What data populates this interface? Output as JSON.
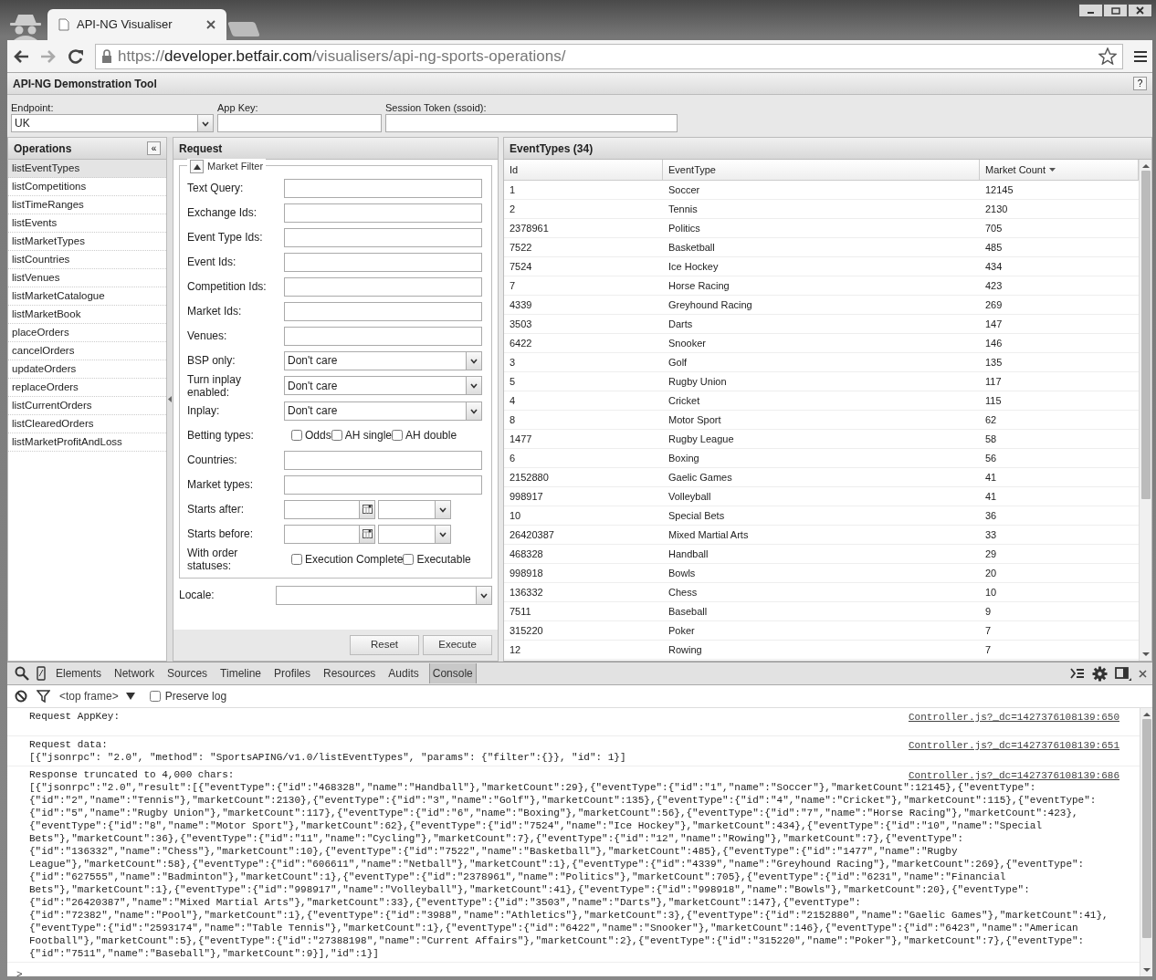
{
  "browser": {
    "tab": {
      "title": "API-NG Visualiser"
    },
    "address": {
      "scheme": "https://",
      "host": "developer.betfair.com",
      "path": "/visualisers/api-ng-sports-operations/"
    }
  },
  "app": {
    "title": "API-NG Demonstration Tool",
    "help": "?",
    "connection": [
      {
        "label": "Endpoint:",
        "kind": "select",
        "value": "UK"
      },
      {
        "label": "App Key:",
        "kind": "text"
      },
      {
        "label": "Session Token (ssoid):",
        "kind": "text"
      }
    ],
    "operations": {
      "title": "Operations",
      "collapse": "«",
      "items": [
        {
          "label": "listEventTypes",
          "selected": true
        },
        {
          "label": "listCompetitions",
          "selected": false
        },
        {
          "label": "listTimeRanges",
          "selected": false
        },
        {
          "label": "listEvents",
          "selected": false
        },
        {
          "label": "listMarketTypes",
          "selected": false
        },
        {
          "label": "listCountries",
          "selected": false
        },
        {
          "label": "listVenues",
          "selected": false
        },
        {
          "label": "listMarketCatalogue",
          "selected": false
        },
        {
          "label": "listMarketBook",
          "selected": false
        },
        {
          "label": "placeOrders",
          "selected": false
        },
        {
          "label": "cancelOrders",
          "selected": false
        },
        {
          "label": "updateOrders",
          "selected": false
        },
        {
          "label": "replaceOrders",
          "selected": false
        },
        {
          "label": "listCurrentOrders",
          "selected": false
        },
        {
          "label": "listClearedOrders",
          "selected": false
        },
        {
          "label": "listMarketProfitAndLoss",
          "selected": false
        }
      ]
    },
    "request": {
      "title": "Request",
      "filter_title": "Market Filter",
      "fields": [
        {
          "label": "Text Query:",
          "kind": "text"
        },
        {
          "label": "Exchange Ids:",
          "kind": "text"
        },
        {
          "label": "Event Type Ids:",
          "kind": "text"
        },
        {
          "label": "Event Ids:",
          "kind": "text"
        },
        {
          "label": "Competition Ids:",
          "kind": "text"
        },
        {
          "label": "Market Ids:",
          "kind": "text"
        },
        {
          "label": "Venues:",
          "kind": "text"
        },
        {
          "label": "BSP only:",
          "kind": "select",
          "value": "Don't care"
        },
        {
          "label": "Turn inplay enabled:",
          "kind": "select",
          "value": "Don't care"
        },
        {
          "label": "Inplay:",
          "kind": "select",
          "value": "Don't care"
        },
        {
          "label": "Betting types:",
          "kind": "checks",
          "options": [
            {
              "label": "Odds",
              "checked": false
            },
            {
              "label": "AH single",
              "checked": false
            },
            {
              "label": "AH double",
              "checked": false
            }
          ]
        },
        {
          "label": "Countries:",
          "kind": "text"
        },
        {
          "label": "Market types:",
          "kind": "text"
        },
        {
          "label": "Starts after:",
          "kind": "date"
        },
        {
          "label": "Starts before:",
          "kind": "date"
        },
        {
          "label": "With order statuses:",
          "kind": "checks",
          "options": [
            {
              "label": "Execution Complete",
              "checked": false
            },
            {
              "label": "Executable",
              "checked": false
            }
          ]
        }
      ],
      "locale": {
        "label": "Locale:"
      },
      "buttons": [
        "Reset",
        "Execute"
      ]
    },
    "results": {
      "title": "EventTypes (34)",
      "columns": [
        {
          "label": "Id",
          "sorted": false
        },
        {
          "label": "EventType",
          "sorted": false
        },
        {
          "label": "Market Count",
          "sorted": true
        }
      ],
      "rows": [
        [
          "1",
          "Soccer",
          "12145"
        ],
        [
          "2",
          "Tennis",
          "2130"
        ],
        [
          "2378961",
          "Politics",
          "705"
        ],
        [
          "7522",
          "Basketball",
          "485"
        ],
        [
          "7524",
          "Ice Hockey",
          "434"
        ],
        [
          "7",
          "Horse Racing",
          "423"
        ],
        [
          "4339",
          "Greyhound Racing",
          "269"
        ],
        [
          "3503",
          "Darts",
          "147"
        ],
        [
          "6422",
          "Snooker",
          "146"
        ],
        [
          "3",
          "Golf",
          "135"
        ],
        [
          "5",
          "Rugby Union",
          "117"
        ],
        [
          "4",
          "Cricket",
          "115"
        ],
        [
          "8",
          "Motor Sport",
          "62"
        ],
        [
          "1477",
          "Rugby League",
          "58"
        ],
        [
          "6",
          "Boxing",
          "56"
        ],
        [
          "2152880",
          "Gaelic Games",
          "41"
        ],
        [
          "998917",
          "Volleyball",
          "41"
        ],
        [
          "10",
          "Special Bets",
          "36"
        ],
        [
          "26420387",
          "Mixed Martial Arts",
          "33"
        ],
        [
          "468328",
          "Handball",
          "29"
        ],
        [
          "998918",
          "Bowls",
          "20"
        ],
        [
          "136332",
          "Chess",
          "10"
        ],
        [
          "7511",
          "Baseball",
          "9"
        ],
        [
          "315220",
          "Poker",
          "7"
        ],
        [
          "12",
          "Rowing",
          "7"
        ]
      ]
    }
  },
  "devtools": {
    "tabs": [
      {
        "label": "Elements",
        "selected": false
      },
      {
        "label": "Network",
        "selected": false
      },
      {
        "label": "Sources",
        "selected": false
      },
      {
        "label": "Timeline",
        "selected": false
      },
      {
        "label": "Profiles",
        "selected": false
      },
      {
        "label": "Resources",
        "selected": false
      },
      {
        "label": "Audits",
        "selected": false
      },
      {
        "label": "Console",
        "selected": true
      }
    ],
    "frame": "<top frame>",
    "preserve_log": {
      "label": "Preserve log",
      "checked": false
    },
    "messages": [
      {
        "source": "Controller.js?_dc=1427376108139:650",
        "lines": [
          "Request AppKey:"
        ]
      },
      {
        "source": "Controller.js?_dc=1427376108139:651",
        "lines": [
          "Request data:",
          "[{\"jsonrpc\": \"2.0\", \"method\": \"SportsAPING/v1.0/listEventTypes\", \"params\": {\"filter\":{}}, \"id\": 1}]"
        ]
      },
      {
        "source": "Controller.js?_dc=1427376108139:686",
        "lines": [
          "Response truncated to 4,000 chars:",
          "[{\"jsonrpc\":\"2.0\",\"result\":[{\"eventType\":{\"id\":\"468328\",\"name\":\"Handball\"},\"marketCount\":29},{\"eventType\":{\"id\":\"1\",\"name\":\"Soccer\"},\"marketCount\":12145},{\"eventType\":",
          "{\"id\":\"2\",\"name\":\"Tennis\"},\"marketCount\":2130},{\"eventType\":{\"id\":\"3\",\"name\":\"Golf\"},\"marketCount\":135},{\"eventType\":{\"id\":\"4\",\"name\":\"Cricket\"},\"marketCount\":115},{\"eventType\":",
          "{\"id\":\"5\",\"name\":\"Rugby Union\"},\"marketCount\":117},{\"eventType\":{\"id\":\"6\",\"name\":\"Boxing\"},\"marketCount\":56},{\"eventType\":{\"id\":\"7\",\"name\":\"Horse Racing\"},\"marketCount\":423},",
          "{\"eventType\":{\"id\":\"8\",\"name\":\"Motor Sport\"},\"marketCount\":62},{\"eventType\":{\"id\":\"7524\",\"name\":\"Ice Hockey\"},\"marketCount\":434},{\"eventType\":{\"id\":\"10\",\"name\":\"Special",
          "Bets\"},\"marketCount\":36},{\"eventType\":{\"id\":\"11\",\"name\":\"Cycling\"},\"marketCount\":7},{\"eventType\":{\"id\":\"12\",\"name\":\"Rowing\"},\"marketCount\":7},{\"eventType\":",
          "{\"id\":\"136332\",\"name\":\"Chess\"},\"marketCount\":10},{\"eventType\":{\"id\":\"7522\",\"name\":\"Basketball\"},\"marketCount\":485},{\"eventType\":{\"id\":\"1477\",\"name\":\"Rugby",
          "League\"},\"marketCount\":58},{\"eventType\":{\"id\":\"606611\",\"name\":\"Netball\"},\"marketCount\":1},{\"eventType\":{\"id\":\"4339\",\"name\":\"Greyhound Racing\"},\"marketCount\":269},{\"eventType\":",
          "{\"id\":\"627555\",\"name\":\"Badminton\"},\"marketCount\":1},{\"eventType\":{\"id\":\"2378961\",\"name\":\"Politics\"},\"marketCount\":705},{\"eventType\":{\"id\":\"6231\",\"name\":\"Financial",
          "Bets\"},\"marketCount\":1},{\"eventType\":{\"id\":\"998917\",\"name\":\"Volleyball\"},\"marketCount\":41},{\"eventType\":{\"id\":\"998918\",\"name\":\"Bowls\"},\"marketCount\":20},{\"eventType\":",
          "{\"id\":\"26420387\",\"name\":\"Mixed Martial Arts\"},\"marketCount\":33},{\"eventType\":{\"id\":\"3503\",\"name\":\"Darts\"},\"marketCount\":147},{\"eventType\":",
          "{\"id\":\"72382\",\"name\":\"Pool\"},\"marketCount\":1},{\"eventType\":{\"id\":\"3988\",\"name\":\"Athletics\"},\"marketCount\":3},{\"eventType\":{\"id\":\"2152880\",\"name\":\"Gaelic Games\"},\"marketCount\":41},",
          "{\"eventType\":{\"id\":\"2593174\",\"name\":\"Table Tennis\"},\"marketCount\":1},{\"eventType\":{\"id\":\"6422\",\"name\":\"Snooker\"},\"marketCount\":146},{\"eventType\":{\"id\":\"6423\",\"name\":\"American",
          "Football\"},\"marketCount\":5},{\"eventType\":{\"id\":\"27388198\",\"name\":\"Current Affairs\"},\"marketCount\":2},{\"eventType\":{\"id\":\"315220\",\"name\":\"Poker\"},\"marketCount\":7},{\"eventType\":",
          "{\"id\":\"7511\",\"name\":\"Baseball\"},\"marketCount\":9}],\"id\":1}]"
        ]
      }
    ],
    "prompt": ">"
  }
}
